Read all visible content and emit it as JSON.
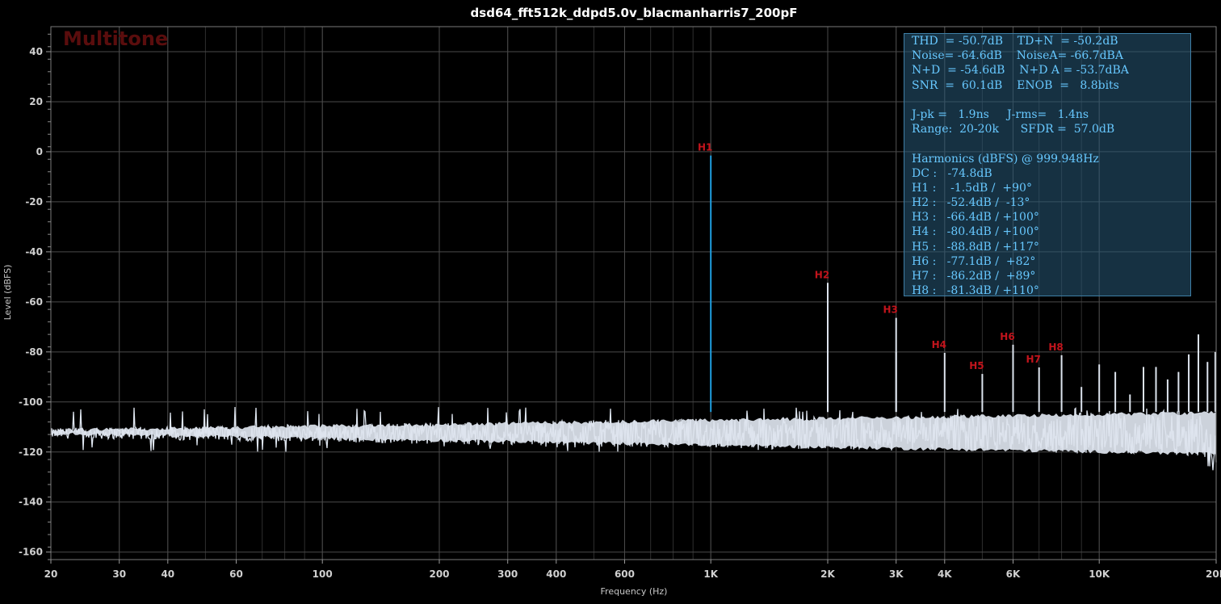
{
  "chart_data": {
    "type": "line",
    "title": "dsd64_fft512k_ddpd5.0v_blacmanharris7_200pF",
    "xlabel": "Frequency (Hz)",
    "ylabel": "Level (dBFS)",
    "xscale": "log",
    "xlim": [
      20,
      20000
    ],
    "ylim": [
      -163,
      50
    ],
    "grid": true,
    "x_ticks": [
      {
        "v": 20,
        "label": "20"
      },
      {
        "v": 30,
        "label": "30"
      },
      {
        "v": 40,
        "label": "40"
      },
      {
        "v": 60,
        "label": "60"
      },
      {
        "v": 100,
        "label": "100"
      },
      {
        "v": 200,
        "label": "200"
      },
      {
        "v": 300,
        "label": "300"
      },
      {
        "v": 400,
        "label": "400"
      },
      {
        "v": 600,
        "label": "600"
      },
      {
        "v": 1000,
        "label": "1K"
      },
      {
        "v": 2000,
        "label": "2K"
      },
      {
        "v": 3000,
        "label": "3K"
      },
      {
        "v": 4000,
        "label": "4K"
      },
      {
        "v": 6000,
        "label": "6K"
      },
      {
        "v": 10000,
        "label": "10K"
      },
      {
        "v": 20000,
        "label": "20K"
      }
    ],
    "y_ticks": [
      40,
      20,
      0,
      -20,
      -40,
      -60,
      -80,
      -100,
      -120,
      -140,
      -160
    ],
    "watermark": "Multitone",
    "noise_floor": {
      "min": -120,
      "max": -102,
      "mean": -112.5
    },
    "harmonic_markers": [
      {
        "label": "H1",
        "x": 1000,
        "y": -1.5,
        "color": "#1f9fe0"
      },
      {
        "label": "H2",
        "x": 2000,
        "y": -52.4,
        "color": "#dde4ee"
      },
      {
        "label": "H3",
        "x": 3000,
        "y": -66.4,
        "color": "#dde4ee"
      },
      {
        "label": "H4",
        "x": 4000,
        "y": -80.4,
        "color": "#dde4ee"
      },
      {
        "label": "H5",
        "x": 5000,
        "y": -88.8,
        "color": "#dde4ee"
      },
      {
        "label": "H6",
        "x": 6000,
        "y": -77.1,
        "color": "#dde4ee"
      },
      {
        "label": "H7",
        "x": 7000,
        "y": -86.2,
        "color": "#dde4ee"
      },
      {
        "label": "H8",
        "x": 8000,
        "y": -81.3,
        "color": "#dde4ee"
      }
    ],
    "other_spurs": [
      {
        "x": 9000,
        "y": -94
      },
      {
        "x": 10000,
        "y": -85
      },
      {
        "x": 11000,
        "y": -88
      },
      {
        "x": 12000,
        "y": -97
      },
      {
        "x": 13000,
        "y": -86
      },
      {
        "x": 14000,
        "y": -86
      },
      {
        "x": 15000,
        "y": -91
      },
      {
        "x": 16000,
        "y": -88
      },
      {
        "x": 17000,
        "y": -81
      },
      {
        "x": 18000,
        "y": -73
      },
      {
        "x": 19000,
        "y": -84
      },
      {
        "x": 19900,
        "y": -80
      }
    ],
    "secondary_spurs": [
      {
        "x": 3000,
        "y": -80
      },
      {
        "x": 2000,
        "y": -102
      }
    ]
  },
  "stats_panel": {
    "lines": [
      "THD  = -50.7dB    TD+N  = -50.2dB",
      "Noise= -64.6dB    NoiseA= -66.7dBA",
      "N+D  = -54.6dB    N+D A = -53.7dBA",
      "SNR  =  60.1dB    ENOB  =   8.8bits",
      "",
      "J-pk =   1.9ns     J-rms=   1.4ns",
      "Range:  20-20k      SFDR =  57.0dB",
      "",
      "Harmonics (dBFS) @ 999.948Hz",
      "DC :   -74.8dB",
      "H1 :    -1.5dB /  +90°",
      "H2 :   -52.4dB /  -13°",
      "H3 :   -66.4dB / +100°",
      "H4 :   -80.4dB / +100°",
      "H5 :   -88.8dB / +117°",
      "H6 :   -77.1dB /  +82°",
      "H7 :   -86.2dB /  +89°",
      "H8 :   -81.3dB / +110°"
    ]
  },
  "colors": {
    "background": "#000000",
    "grid": "#3a3a3a",
    "noise_trace": "#dde4ee",
    "fundamental": "#1f9fe0",
    "harmonic_label": "#c2141c",
    "stats_text": "#67c8ff"
  }
}
